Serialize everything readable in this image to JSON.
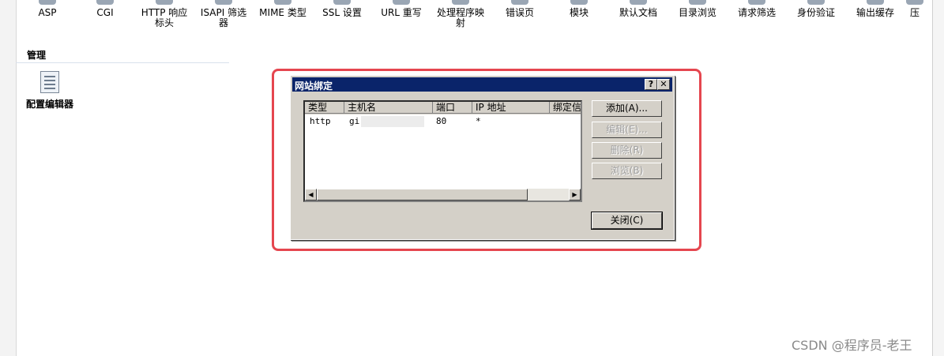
{
  "features": [
    {
      "label": "ASP",
      "icon": "asp-icon"
    },
    {
      "label": "CGI",
      "icon": "cgi-icon"
    },
    {
      "label": "HTTP 响应标头",
      "icon": "http-headers-icon"
    },
    {
      "label": "ISAPI 筛选器",
      "icon": "isapi-filters-icon"
    },
    {
      "label": "MIME 类型",
      "icon": "mime-types-icon"
    },
    {
      "label": "SSL 设置",
      "icon": "ssl-icon"
    },
    {
      "label": "URL 重写",
      "icon": "url-rewrite-icon"
    },
    {
      "label": "处理程序映射",
      "icon": "handler-mappings-icon"
    },
    {
      "label": "错误页",
      "icon": "error-pages-icon"
    },
    {
      "label": "模块",
      "icon": "modules-icon"
    },
    {
      "label": "默认文档",
      "icon": "default-document-icon"
    },
    {
      "label": "目录浏览",
      "icon": "directory-browsing-icon"
    },
    {
      "label": "请求筛选",
      "icon": "request-filtering-icon"
    },
    {
      "label": "身份验证",
      "icon": "authentication-icon"
    },
    {
      "label": "输出缓存",
      "icon": "output-caching-icon"
    },
    {
      "label": "压",
      "icon": "compression-icon"
    }
  ],
  "management": {
    "title": "管理",
    "config_editor_label": "配置编辑器"
  },
  "dialog": {
    "title": "网站绑定",
    "help_glyph": "?",
    "close_glyph": "✕",
    "columns": [
      "类型",
      "主机名",
      "端口",
      "IP 地址",
      "绑定信"
    ],
    "rows": [
      {
        "type": "http",
        "host": "gi",
        "port": "80",
        "ip": "*",
        "info": ""
      }
    ],
    "buttons": {
      "add": "添加(A)...",
      "edit": "编辑(E)...",
      "remove": "删除(R)",
      "browse": "浏览(B)",
      "close": "关闭(C)"
    }
  },
  "watermark": "CSDN @程序员-老王"
}
